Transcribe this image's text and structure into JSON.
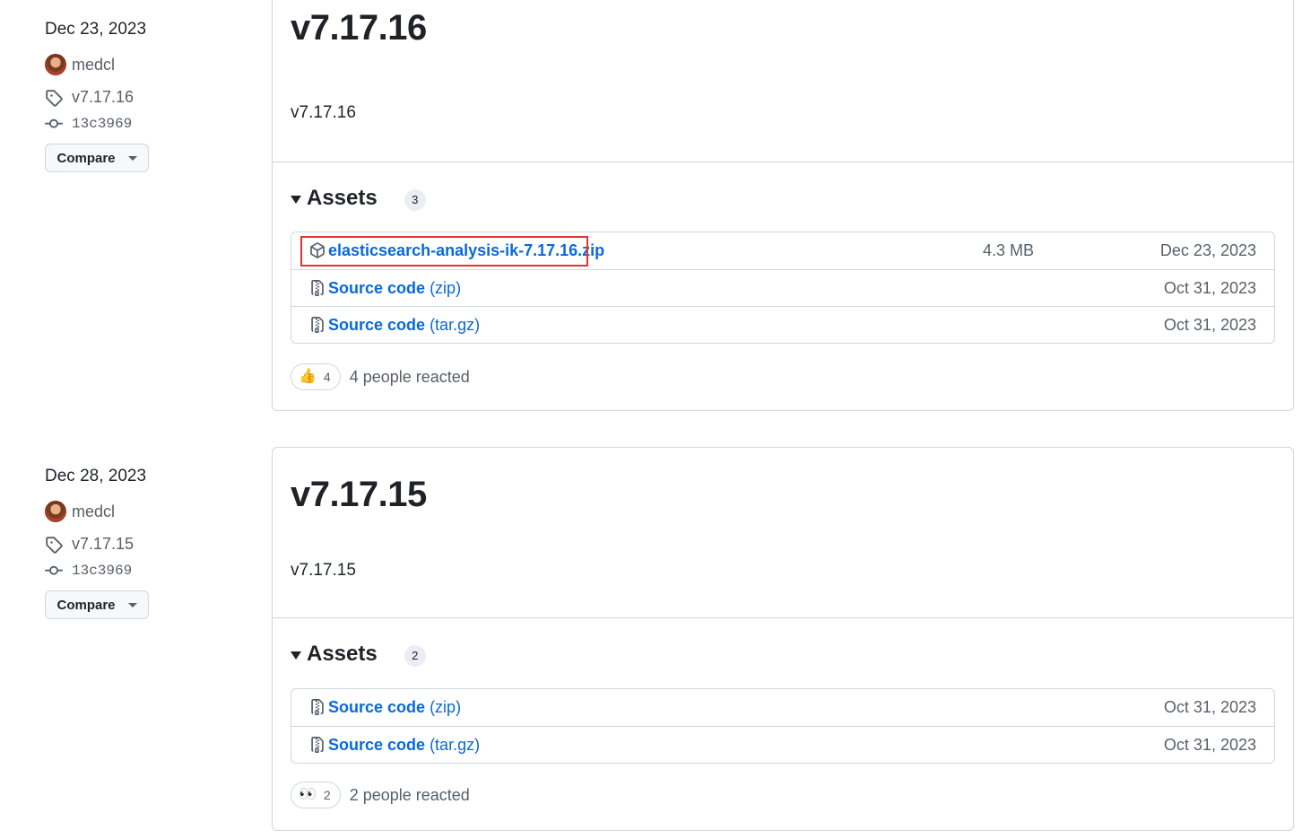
{
  "releases": [
    {
      "date": "Dec 23, 2023",
      "author": "medcl",
      "tag": "v7.17.16",
      "commit": "13c3969",
      "compare_label": "Compare",
      "title": "v7.17.16",
      "body": "v7.17.16",
      "assets_label": "Assets",
      "assets_count": "3",
      "assets": [
        {
          "name": "elasticsearch-analysis-ik-7.17.16.zip",
          "ext": "",
          "size": "4.3 MB",
          "date": "Dec 23, 2023",
          "icon": "package-icon"
        },
        {
          "name": "Source code",
          "ext": "(zip)",
          "size": "",
          "date": "Oct 31, 2023",
          "icon": "file-zip-icon"
        },
        {
          "name": "Source code",
          "ext": "(tar.gz)",
          "size": "",
          "date": "Oct 31, 2023",
          "icon": "file-zip-icon"
        }
      ],
      "reaction_emoji": "👍",
      "reaction_count": "4",
      "reaction_text": "4 people reacted"
    },
    {
      "date": "Dec 28, 2023",
      "author": "medcl",
      "tag": "v7.17.15",
      "commit": "13c3969",
      "compare_label": "Compare",
      "title": "v7.17.15",
      "body": "v7.17.15",
      "assets_label": "Assets",
      "assets_count": "2",
      "assets": [
        {
          "name": "Source code",
          "ext": "(zip)",
          "size": "",
          "date": "Oct 31, 2023",
          "icon": "file-zip-icon"
        },
        {
          "name": "Source code",
          "ext": "(tar.gz)",
          "size": "",
          "date": "Oct 31, 2023",
          "icon": "file-zip-icon"
        }
      ],
      "reaction_emoji": "👀",
      "reaction_count": "2",
      "reaction_text": "2 people reacted"
    }
  ],
  "colors": {
    "link": "#0969da",
    "muted": "#57606a",
    "border": "#d0d7de",
    "highlight": "#e5322d"
  }
}
